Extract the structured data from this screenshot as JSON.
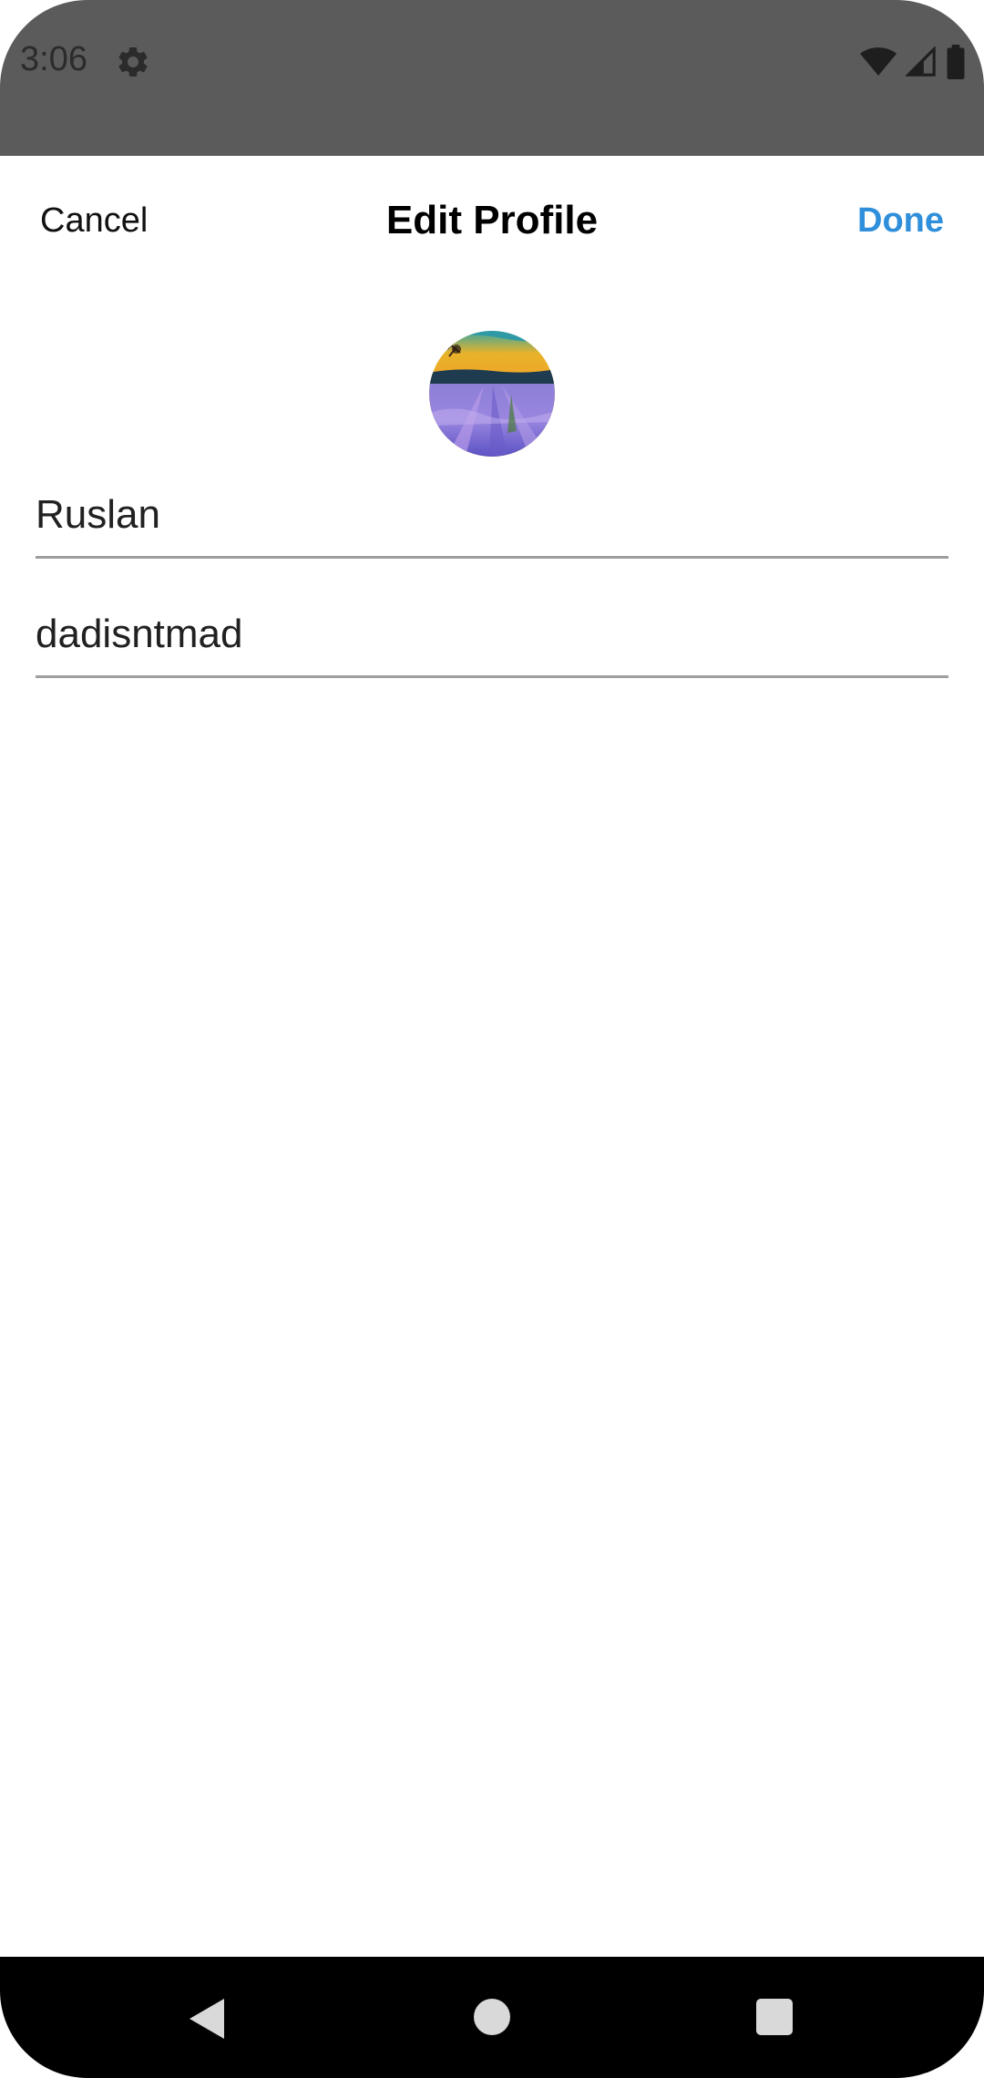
{
  "status_bar": {
    "time": "3:06",
    "icons": [
      "settings-gear-icon",
      "wifi-icon",
      "signal-icon",
      "battery-icon"
    ],
    "background": "#5b5b5b"
  },
  "header": {
    "cancel_label": "Cancel",
    "title": "Edit Profile",
    "done_label": "Done",
    "done_color": "#2f8fdb"
  },
  "profile": {
    "avatar": "lavender-field-painting"
  },
  "form": {
    "name_value": "Ruslan",
    "username_value": "dadisntmad"
  },
  "nav_bar": {
    "buttons": [
      "back-icon",
      "home-icon",
      "recents-icon"
    ]
  }
}
